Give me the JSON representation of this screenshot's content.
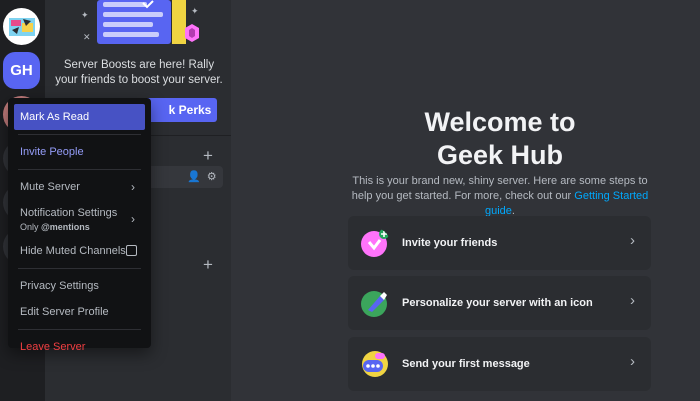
{
  "rail": {
    "servers": [
      "GH"
    ]
  },
  "sidebar": {
    "boost_text": "Server Boosts are here! Rally your friends to boost your server.",
    "perks_button": "k Perks"
  },
  "context_menu": {
    "items": [
      {
        "label": "Mark As Read"
      },
      {
        "label": "Invite People"
      },
      {
        "label": "Mute Server"
      },
      {
        "label": "Notification Settings",
        "sub_prefix": "Only ",
        "sub_bold": "@mentions"
      },
      {
        "label": "Hide Muted Channels"
      },
      {
        "label": "Privacy Settings"
      },
      {
        "label": "Edit Server Profile"
      },
      {
        "label": "Leave Server"
      }
    ]
  },
  "main": {
    "title_line1": "Welcome to",
    "title_line2": "Geek Hub",
    "description": "This is your brand new, shiny server. Here are some steps to help you get started. For more, check out our ",
    "guide_link": "Getting Started guide",
    "guide_end": ".",
    "cards": [
      {
        "label": "Invite your friends",
        "icon": "invite-icon"
      },
      {
        "label": "Personalize your server with an icon",
        "icon": "personalize-icon"
      },
      {
        "label": "Send your first message",
        "icon": "message-icon"
      }
    ]
  },
  "colors": {
    "accent": "#5865f2",
    "menu_active": "#4752c4",
    "danger": "#f23f42",
    "link": "#00a8fc"
  }
}
